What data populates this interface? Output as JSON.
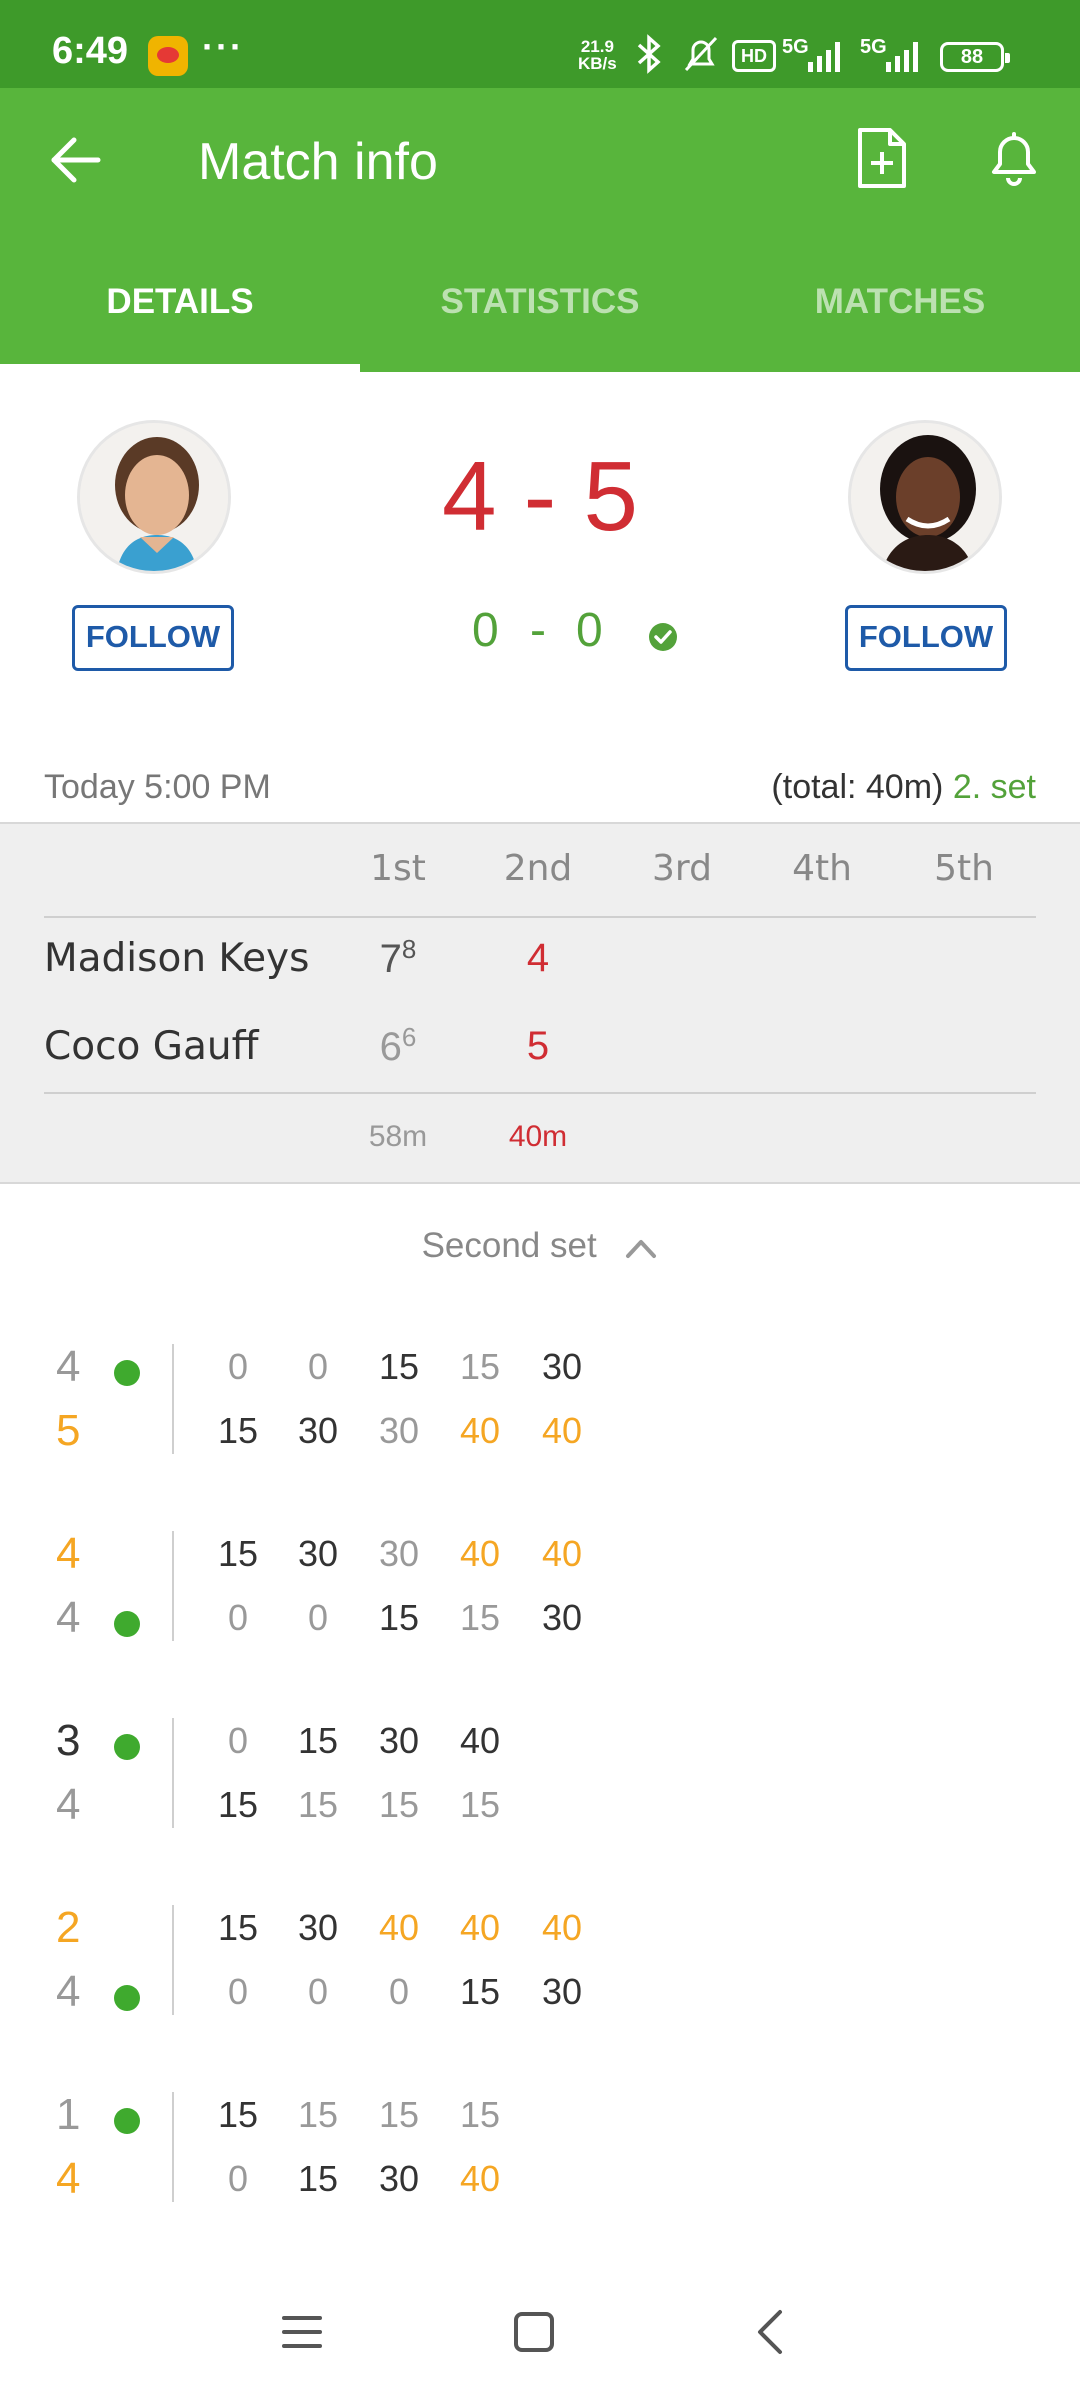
{
  "status_bar": {
    "time": "6:49",
    "dots": "···",
    "speed_top": "21.9",
    "speed_bottom": "KB/s",
    "hd": "HD",
    "net1": "5G",
    "net2": "5G",
    "battery": "88"
  },
  "app_bar": {
    "title": "Match info"
  },
  "tabs": [
    {
      "label": "DETAILS"
    },
    {
      "label": "STATISTICS"
    },
    {
      "label": "MATCHES"
    }
  ],
  "match": {
    "score_main": "4 - 5",
    "game_home": "0",
    "game_dash": "-",
    "game_away": "0",
    "follow_left": "FOLLOW",
    "follow_right": "FOLLOW",
    "start": "Today 5:00 PM",
    "total": "(total: 40m)",
    "current_set": "2. set"
  },
  "set_table": {
    "headers": [
      "1st",
      "2nd",
      "3rd",
      "4th",
      "5th"
    ],
    "players": [
      {
        "name": "Madison Keys",
        "set1": "7",
        "set1_tb": "8",
        "set2": "4"
      },
      {
        "name": "Coco Gauff",
        "set1": "6",
        "set1_tb": "6",
        "set2": "5"
      }
    ],
    "durations": [
      "58m",
      "40m"
    ]
  },
  "section": {
    "title": "Second set"
  },
  "games": [
    {
      "top_score": "4",
      "top_color": "grey",
      "top_serve": true,
      "top_points": [
        "0",
        "0",
        "15",
        "15",
        "30"
      ],
      "top_colors": [
        "grey",
        "grey",
        "dark",
        "grey",
        "dark"
      ],
      "bot_score": "5",
      "bot_color": "gold",
      "bot_serve": false,
      "bot_points": [
        "15",
        "30",
        "30",
        "40",
        "40"
      ],
      "bot_colors": [
        "dark",
        "dark",
        "grey",
        "gold",
        "gold"
      ]
    },
    {
      "top_score": "4",
      "top_color": "gold",
      "top_serve": false,
      "top_points": [
        "15",
        "30",
        "30",
        "40",
        "40"
      ],
      "top_colors": [
        "dark",
        "dark",
        "grey",
        "gold",
        "gold"
      ],
      "bot_score": "4",
      "bot_color": "grey",
      "bot_serve": true,
      "bot_points": [
        "0",
        "0",
        "15",
        "15",
        "30"
      ],
      "bot_colors": [
        "grey",
        "grey",
        "dark",
        "grey",
        "dark"
      ]
    },
    {
      "top_score": "3",
      "top_color": "dark",
      "top_serve": true,
      "top_points": [
        "0",
        "15",
        "30",
        "40"
      ],
      "top_colors": [
        "grey",
        "dark",
        "dark",
        "dark"
      ],
      "bot_score": "4",
      "bot_color": "grey",
      "bot_serve": false,
      "bot_points": [
        "15",
        "15",
        "15",
        "15"
      ],
      "bot_colors": [
        "dark",
        "grey",
        "grey",
        "grey"
      ]
    },
    {
      "top_score": "2",
      "top_color": "gold",
      "top_serve": false,
      "top_points": [
        "15",
        "30",
        "40",
        "40",
        "40"
      ],
      "top_colors": [
        "dark",
        "dark",
        "gold",
        "gold",
        "gold"
      ],
      "bot_score": "4",
      "bot_color": "grey",
      "bot_serve": true,
      "bot_points": [
        "0",
        "0",
        "0",
        "15",
        "30"
      ],
      "bot_colors": [
        "grey",
        "grey",
        "grey",
        "dark",
        "dark"
      ]
    },
    {
      "top_score": "1",
      "top_color": "grey",
      "top_serve": true,
      "top_points": [
        "15",
        "15",
        "15",
        "15"
      ],
      "top_colors": [
        "dark",
        "grey",
        "grey",
        "grey"
      ],
      "bot_score": "4",
      "bot_color": "gold",
      "bot_serve": false,
      "bot_points": [
        "0",
        "15",
        "30",
        "40"
      ],
      "bot_colors": [
        "grey",
        "dark",
        "dark",
        "gold"
      ]
    }
  ],
  "colors": {
    "status_bar": "#3e9a2a",
    "app_bar": "#58b53c",
    "score_red": "#d02d33",
    "game_green": "#53a23a",
    "follow_blue": "#1e5aa8",
    "point_gold": "#f5a623"
  }
}
